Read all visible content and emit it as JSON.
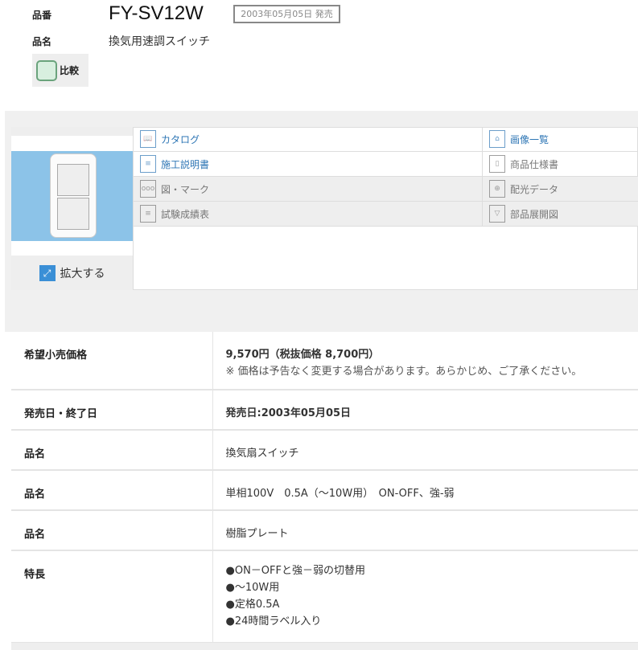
{
  "header": {
    "part_number_label": "品番",
    "part_number": "FY-SV12W",
    "release_badge": "2003年05月05日 発売",
    "name_label": "品名",
    "name": "換気用速調スイッチ",
    "compare_label": "比較"
  },
  "gallery": {
    "zoom_label": "拡大する"
  },
  "links": [
    {
      "left": {
        "label": "カタログ",
        "icon": "catalog-book-icon",
        "active": true
      },
      "right": {
        "label": "画像一覧",
        "icon": "image-list-icon",
        "active": true
      }
    },
    {
      "left": {
        "label": "施工説明書",
        "icon": "document-icon",
        "active": true
      },
      "right": {
        "label": "商品仕様書",
        "icon": "spec-sheet-icon",
        "active": false
      }
    },
    {
      "left": {
        "label": "図・マーク",
        "icon": "speech-mark-icon",
        "active": false
      },
      "right": {
        "label": "配光データ",
        "icon": "light-distribution-icon",
        "active": false
      }
    },
    {
      "left": {
        "label": "試験成績表",
        "icon": "document-icon",
        "active": false
      },
      "right": {
        "label": "部品展開図",
        "icon": "screw-icon",
        "active": false
      }
    }
  ],
  "spec": {
    "price_label": "希望小売価格",
    "price": "9,570円（税抜価格 8,700円）",
    "price_note": "※ 価格は予告なく変更する場合があります。あらかじめ、ご了承ください。",
    "date_label": "発売日・終了日",
    "date": "発売日:2003年05月05日",
    "rows": [
      {
        "label": "品名",
        "value": "換気扇スイッチ"
      },
      {
        "label": "品名",
        "value": "単相100V　0.5A（～10W用）　ON-OFF、強-弱"
      },
      {
        "label": "品名",
        "value": "樹脂プレート"
      }
    ],
    "features_label": "特長",
    "features": [
      "●ON－OFFと強－弱の切替用",
      "●～10W用",
      "●定格0.5A",
      "●24時間ラベル入り"
    ]
  }
}
